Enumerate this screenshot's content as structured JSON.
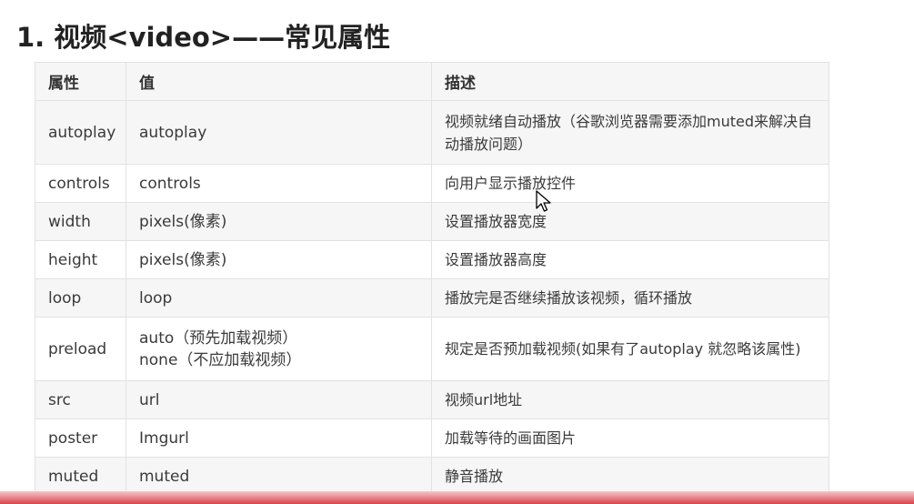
{
  "heading": "1. 视频<video>——常见属性",
  "table": {
    "headers": [
      "属性",
      "值",
      "描述"
    ],
    "rows": [
      {
        "attr": "autoplay",
        "value": [
          "autoplay",
          ""
        ],
        "desc": "视频就绪自动播放（谷歌浏览器需要添加muted来解决自动播放问题）"
      },
      {
        "attr": "controls",
        "value": [
          "controls",
          ""
        ],
        "desc": "向用户显示播放控件"
      },
      {
        "attr": "width",
        "value": [
          "pixels(像素)",
          ""
        ],
        "desc": "设置播放器宽度"
      },
      {
        "attr": "height",
        "value": [
          "pixels(像素)",
          ""
        ],
        "desc": "设置播放器高度"
      },
      {
        "attr": "loop",
        "value": [
          "loop",
          ""
        ],
        "desc": "播放完是否继续播放该视频，循环播放"
      },
      {
        "attr": "preload",
        "value": [
          "auto（预先加载视频）",
          "none（不应加载视频）"
        ],
        "desc": "规定是否预加载视频(如果有了autoplay 就忽略该属性)"
      },
      {
        "attr": "src",
        "value": [
          "url",
          ""
        ],
        "desc": "视频url地址"
      },
      {
        "attr": "poster",
        "value": [
          "Imgurl",
          ""
        ],
        "desc": "加载等待的画面图片"
      },
      {
        "attr": "muted",
        "value": [
          "muted",
          ""
        ],
        "desc": "静音播放"
      }
    ]
  },
  "colors": {
    "header_bg": "#f6f6f6",
    "border": "#e2e2e2",
    "bottom_band": "#d9444b"
  },
  "cursor_icon": "mouse-pointer-icon"
}
